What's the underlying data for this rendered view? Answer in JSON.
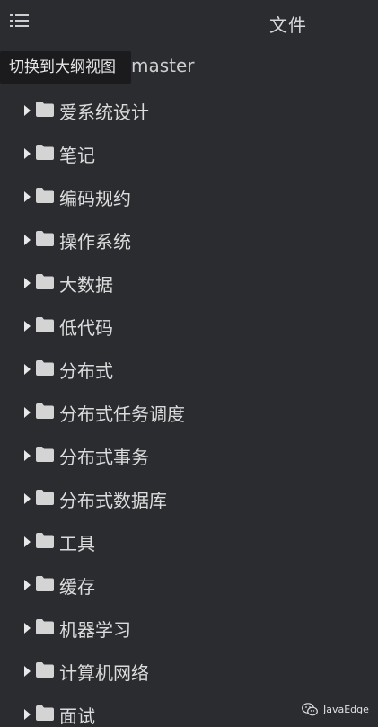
{
  "header": {
    "title": "文件",
    "toggle_icon": "outline-list-icon"
  },
  "tooltip": {
    "text": "切换到大纲视图"
  },
  "root": {
    "label": "master"
  },
  "tree": {
    "items": [
      {
        "label": "爱系统设计",
        "icon": "folder-icon"
      },
      {
        "label": "笔记",
        "icon": "folder-icon"
      },
      {
        "label": "编码规约",
        "icon": "folder-icon"
      },
      {
        "label": "操作系统",
        "icon": "folder-icon"
      },
      {
        "label": "大数据",
        "icon": "folder-icon"
      },
      {
        "label": "低代码",
        "icon": "folder-icon"
      },
      {
        "label": "分布式",
        "icon": "folder-icon"
      },
      {
        "label": "分布式任务调度",
        "icon": "folder-icon"
      },
      {
        "label": "分布式事务",
        "icon": "folder-icon"
      },
      {
        "label": "分布式数据库",
        "icon": "folder-icon"
      },
      {
        "label": "工具",
        "icon": "folder-icon"
      },
      {
        "label": "缓存",
        "icon": "folder-icon"
      },
      {
        "label": "机器学习",
        "icon": "folder-icon"
      },
      {
        "label": "计算机网络",
        "icon": "folder-icon"
      },
      {
        "label": "面试",
        "icon": "folder-icon"
      }
    ]
  },
  "watermark": {
    "text": "JavaEdge",
    "icon": "wechat-icon"
  },
  "colors": {
    "background": "#2b2c30",
    "text": "#dcdcdc",
    "tooltip_bg": "#1b1b1d"
  }
}
